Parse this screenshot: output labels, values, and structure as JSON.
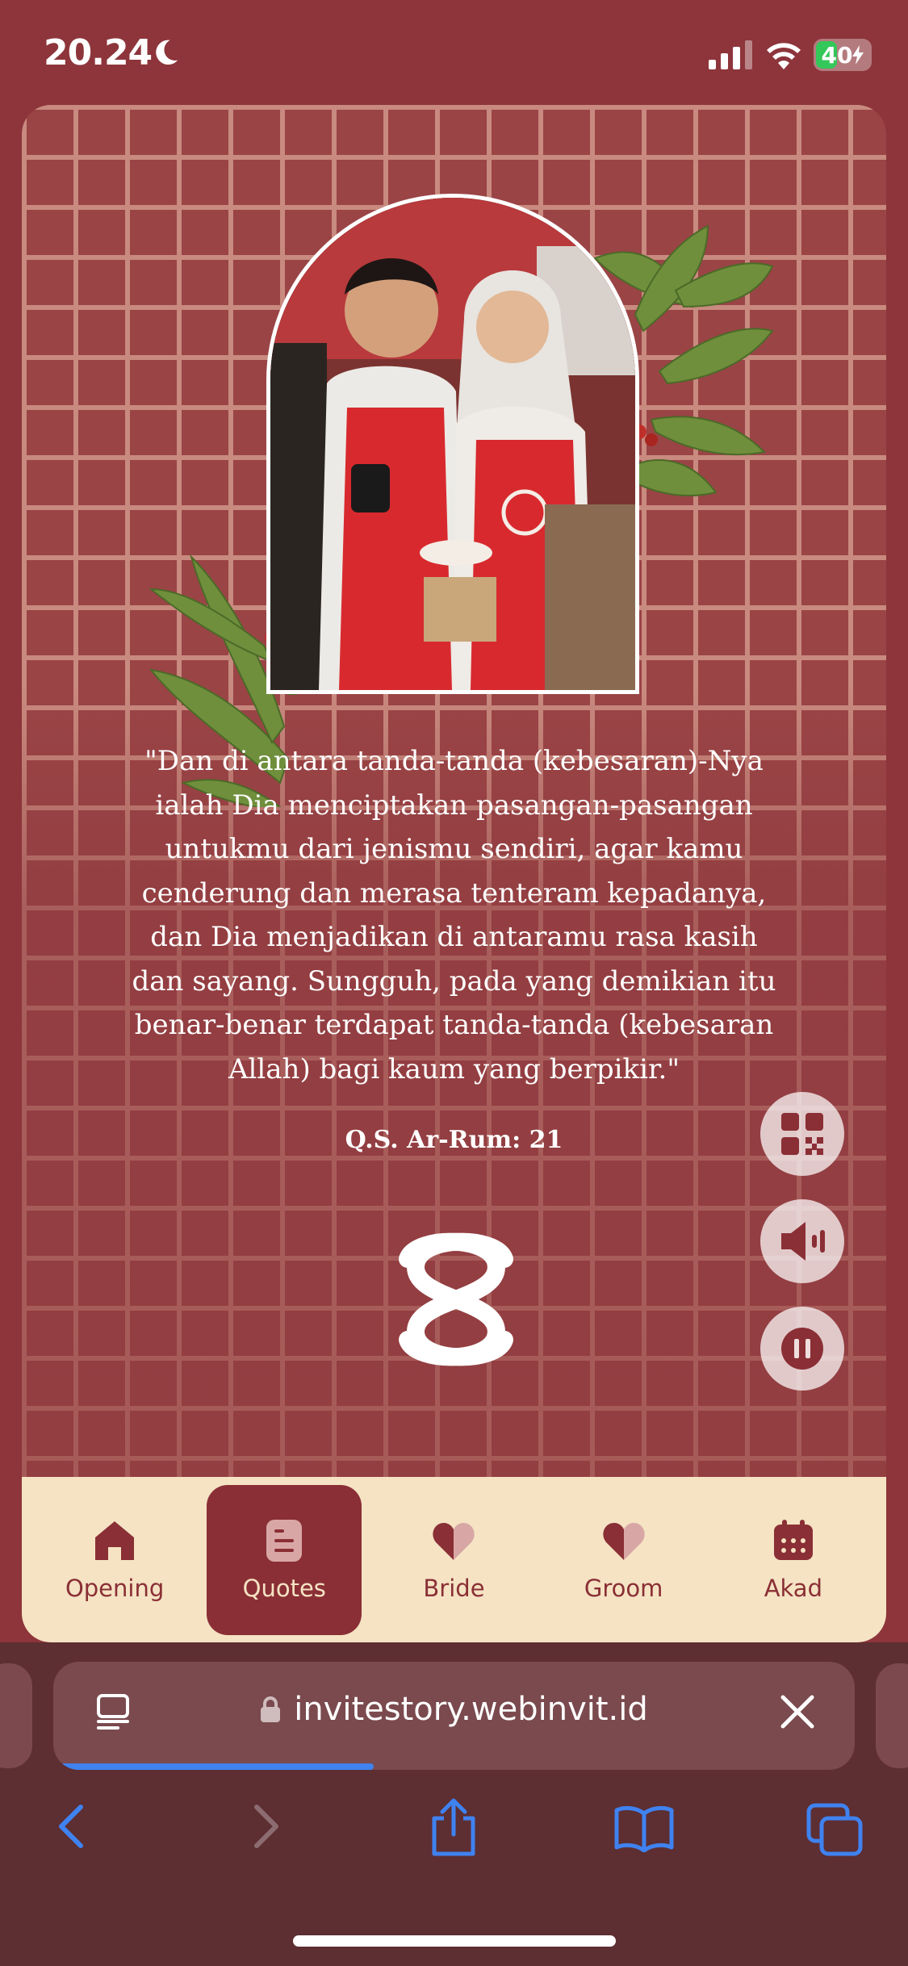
{
  "status_bar": {
    "time": "20.24",
    "battery": "40"
  },
  "quote": {
    "text": "\"Dan di antara tanda-tanda (kebesaran)-Nya ialah Dia menciptakan pasangan-pasangan untukmu dari jenismu sendiri, agar kamu cenderung dan merasa tenteram kepadanya, dan Dia menjadikan di antaramu rasa kasih dan sayang. Sungguh, pada yang demikian itu benar-benar terdapat tanda-tanda (kebesaran Allah) bagi kaum yang berpikir.\"",
    "reference": "Q.S. Ar-Rum: 21"
  },
  "floating_buttons": [
    "qr-code-icon",
    "speaker-icon",
    "pause-icon"
  ],
  "nav": {
    "items": [
      {
        "label": "Opening",
        "icon": "home-icon",
        "active": false
      },
      {
        "label": "Quotes",
        "icon": "quote-icon",
        "active": true
      },
      {
        "label": "Bride",
        "icon": "heart-icon",
        "active": false
      },
      {
        "label": "Groom",
        "icon": "heart-icon",
        "active": false
      },
      {
        "label": "Akad",
        "icon": "calendar-icon",
        "active": false
      }
    ]
  },
  "browser": {
    "url": "invitestory.webinvit.id",
    "load_progress": 0.4
  },
  "colors": {
    "background": "#8d353b",
    "nav_background": "#f5e3c4",
    "accent": "#8a2f35",
    "progress": "#3f82f0"
  }
}
